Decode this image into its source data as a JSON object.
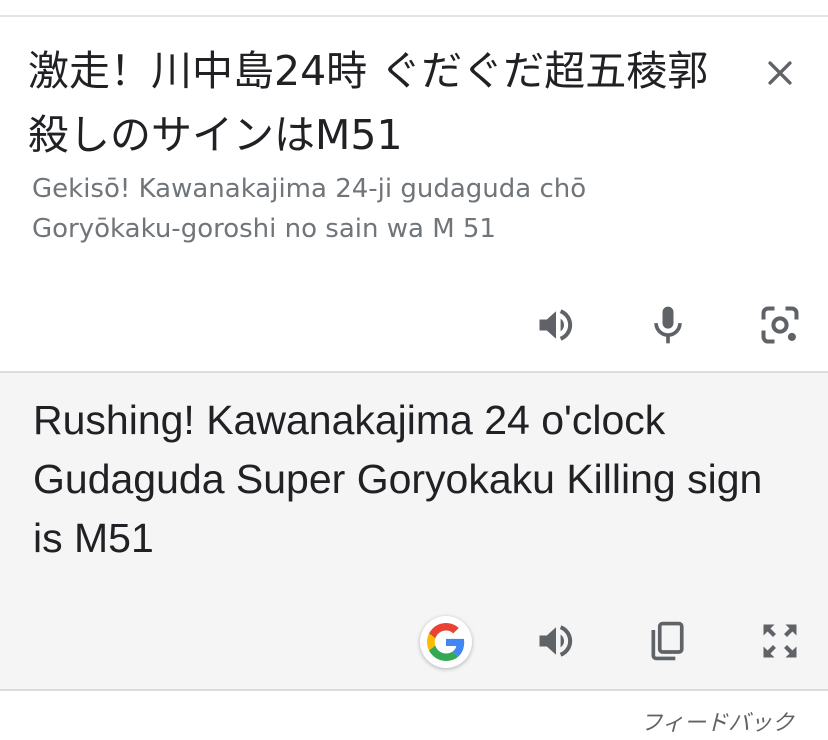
{
  "source": {
    "text": "激走！川中島24時 ぐだぐだ超五稜郭 殺しのサインはM51",
    "romanization": "Gekisō! Kawanakajima 24-ji gudaguda chō Goryōkaku-goroshi no sain wa M 51",
    "icons": [
      "close-icon",
      "speaker-icon",
      "microphone-icon",
      "camera-lens-icon"
    ]
  },
  "target": {
    "text": "Rushing! Kawanakajima 24 o'clock Gudaguda Super Goryokaku Killing sign is M51",
    "icons": [
      "google-logo-icon",
      "speaker-icon",
      "copy-icon",
      "fullscreen-icon"
    ]
  },
  "footer": {
    "feedback_label": "フィードバック"
  },
  "colors": {
    "text": "#202124",
    "secondary_text": "#70757a",
    "icon": "#5f6368",
    "target_background": "#f5f5f5",
    "divider": "#dadce0"
  }
}
